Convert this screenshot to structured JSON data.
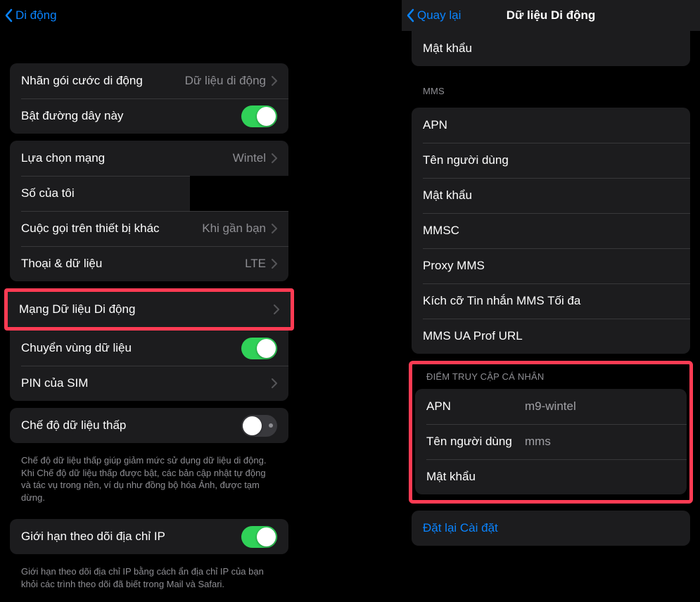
{
  "left": {
    "header": {
      "back": "Di động"
    },
    "group1": {
      "plan_label": "Nhãn gói cước di động",
      "plan_value": "Dữ liệu di động",
      "line_toggle": "Bật đường dây này"
    },
    "group2": {
      "network_sel": "Lựa chọn mạng",
      "network_val": "Wintel",
      "my_number": "Số của tôi",
      "calls_other": "Cuộc gọi trên thiết bị khác",
      "calls_other_val": "Khi gần bạn",
      "voice_data": "Thoại & dữ liệu",
      "voice_data_val": "LTE",
      "mobile_data_net": "Mạng Dữ liệu Di động",
      "roaming": "Chuyển vùng dữ liệu",
      "sim_pin": "PIN của SIM"
    },
    "group3": {
      "low_data": "Chế độ dữ liệu thấp",
      "low_data_desc": "Chế độ dữ liệu thấp giúp giảm mức sử dụng dữ liệu di động. Khi Chế độ dữ liệu thấp được bật, các bản cập nhật tự động và tác vụ trong nền, ví dụ như đồng bộ hóa Ảnh, được tạm dừng."
    },
    "group4": {
      "limit_ip": "Giới hạn theo dõi địa chỉ IP",
      "limit_ip_desc": "Giới hạn theo dõi địa chỉ IP bằng cách ẩn địa chỉ IP của bạn khỏi các trình theo dõi đã biết trong Mail và Safari."
    }
  },
  "right": {
    "header": {
      "back": "Quay lại",
      "title": "Dữ liệu Di động"
    },
    "top_row": "Mật khẩu",
    "mms_header": "MMS",
    "mms": {
      "apn": "APN",
      "user": "Tên người dùng",
      "pass": "Mật khẩu",
      "mmsc": "MMSC",
      "proxy": "Proxy MMS",
      "maxsize": "Kích cỡ Tin nhắn MMS Tối đa",
      "uaprof": "MMS UA Prof URL"
    },
    "hotspot_header": "ĐIỂM TRUY CẬP CÁ NHÂN",
    "hotspot": {
      "apn_label": "APN",
      "apn_val": "m9-wintel",
      "user_label": "Tên người dùng",
      "user_val": "mms",
      "pass_label": "Mật khẩu",
      "pass_val": ""
    },
    "reset": "Đặt lại Cài đặt"
  }
}
